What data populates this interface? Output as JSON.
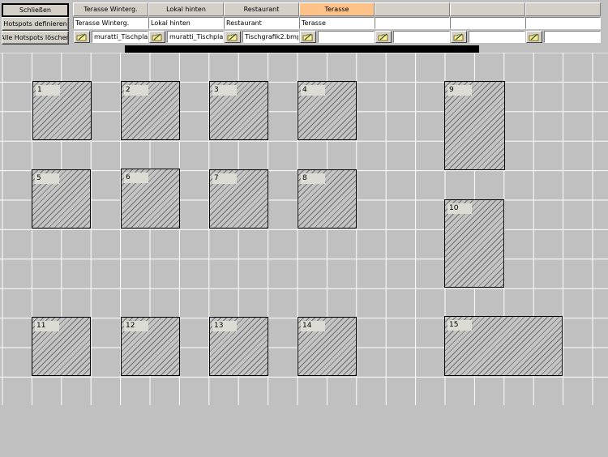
{
  "buttons": {
    "close": "Schließen",
    "define_hotspots": "Hotspots definieren",
    "delete_hotspots": "Alle Hotspots löschen"
  },
  "tabs": [
    {
      "label": "Terasse Winterg.",
      "active": false
    },
    {
      "label": "Lokal hinten",
      "active": false
    },
    {
      "label": "Restaurant",
      "active": false
    },
    {
      "label": "Terasse",
      "active": true
    },
    {
      "label": "",
      "active": false
    },
    {
      "label": "",
      "active": false
    },
    {
      "label": "",
      "active": false
    }
  ],
  "names": [
    "Terasse Winterg.",
    "Lokal hinten",
    "Restaurant",
    "Terasse",
    "",
    "",
    ""
  ],
  "images": [
    "muratti_Tischplan_",
    "muratti_Tischplan_",
    "Tischgrafik2.bmp",
    "",
    "",
    "",
    ""
  ],
  "icons": {
    "browse": "folder-pencil-icon"
  },
  "colors": {
    "active_tab": "#ffc38a",
    "canvas": "#c0c0c0",
    "grid": "#ffffff"
  },
  "tables": [
    "1",
    "2",
    "3",
    "4",
    "5",
    "6",
    "7",
    "8",
    "9",
    "10",
    "11",
    "12",
    "13",
    "14",
    "15"
  ]
}
